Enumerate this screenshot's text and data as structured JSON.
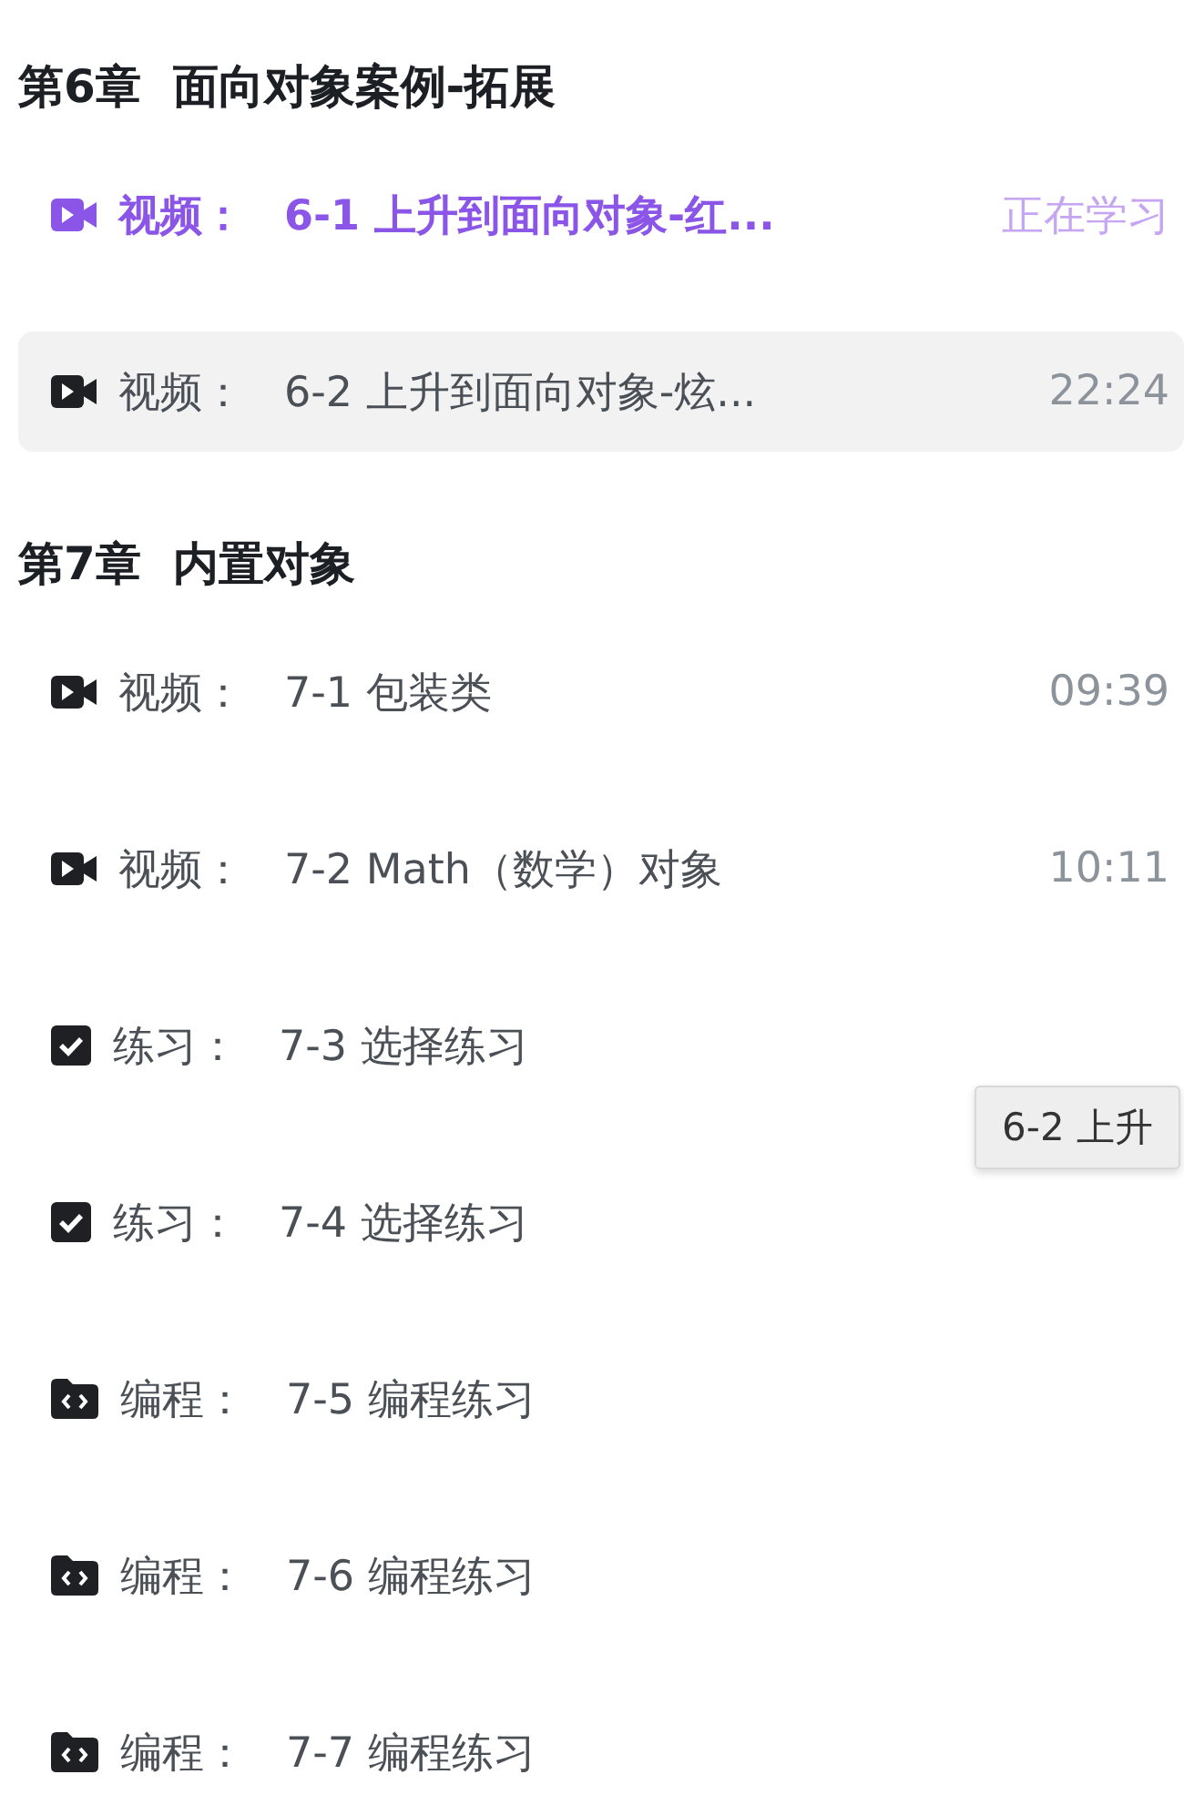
{
  "chapters": [
    {
      "title": "第6章  面向对象案例-拓展",
      "lessons": [
        {
          "kind": "video",
          "type_label": "视频：",
          "title": "6-1 上升到面向对象-红...",
          "meta": "正在学习",
          "current": true,
          "hovered": false
        },
        {
          "kind": "video",
          "type_label": "视频：",
          "title": "6-2 上升到面向对象-炫...",
          "meta": "22:24",
          "current": false,
          "hovered": true
        }
      ]
    },
    {
      "title": "第7章  内置对象",
      "lessons": [
        {
          "kind": "video",
          "type_label": "视频：",
          "title": "7-1 包装类",
          "meta": "09:39",
          "current": false,
          "hovered": false
        },
        {
          "kind": "video",
          "type_label": "视频：",
          "title": "7-2 Math（数学）对象",
          "meta": "10:11",
          "current": false,
          "hovered": false
        },
        {
          "kind": "quiz",
          "type_label": "练习：",
          "title": "7-3 选择练习",
          "current": false,
          "hovered": false
        },
        {
          "kind": "quiz",
          "type_label": "练习：",
          "title": "7-4 选择练习",
          "current": false,
          "hovered": false
        },
        {
          "kind": "code",
          "type_label": "编程：",
          "title": "7-5 编程练习",
          "current": false,
          "hovered": false
        },
        {
          "kind": "code",
          "type_label": "编程：",
          "title": "7-6 编程练习",
          "current": false,
          "hovered": false
        },
        {
          "kind": "code",
          "type_label": "编程：",
          "title": "7-7 编程练习",
          "current": false,
          "hovered": false
        }
      ]
    }
  ],
  "tooltip": {
    "text": "6-2 上升"
  }
}
